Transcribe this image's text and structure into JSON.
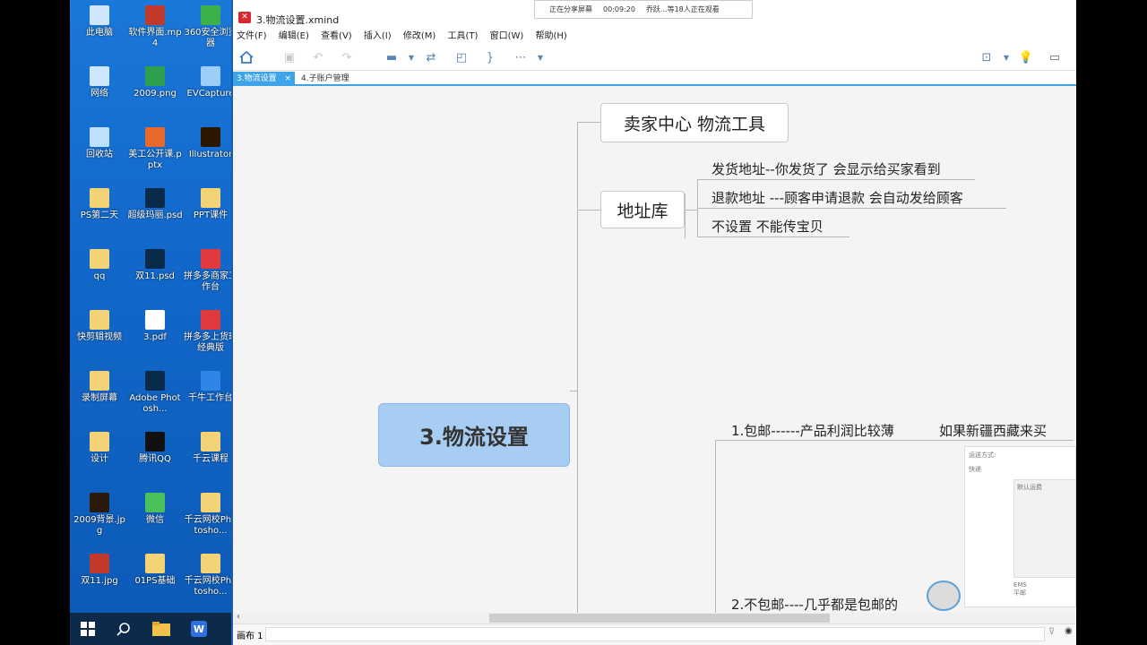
{
  "desktop": {
    "icons": [
      {
        "label": "此电脑",
        "icon": "computer-icon",
        "color": "#cfe6ff"
      },
      {
        "label": "软件界面.mp4",
        "icon": "video-file-icon",
        "color": "#c0392b"
      },
      {
        "label": "360安全浏览器",
        "icon": "browser-360-icon",
        "color": "#3cb04a"
      },
      {
        "label": "网络",
        "icon": "network-icon",
        "color": "#cfe6ff"
      },
      {
        "label": "2009.png",
        "icon": "image-file-icon",
        "color": "#2e9e4f"
      },
      {
        "label": "EVCapture",
        "icon": "evcapture-icon",
        "color": "#9ccef8"
      },
      {
        "label": "回收站",
        "icon": "recycle-bin-icon",
        "color": "#bde0ff"
      },
      {
        "label": "美工公开课.pptx",
        "icon": "pptx-file-icon",
        "color": "#e6682a"
      },
      {
        "label": "Illustrator",
        "icon": "illustrator-icon",
        "color": "#2b1700"
      },
      {
        "label": "PS第二天",
        "icon": "folder-icon",
        "color": "#f3d376"
      },
      {
        "label": "超级玛丽.psd",
        "icon": "psd-file-icon",
        "color": "#0a2a4a"
      },
      {
        "label": "PPT课件",
        "icon": "folder-shortcut-icon",
        "color": "#f3d376"
      },
      {
        "label": "qq",
        "icon": "folder-icon",
        "color": "#f3d376"
      },
      {
        "label": "双11.psd",
        "icon": "psd-file-icon",
        "color": "#0a2a4a"
      },
      {
        "label": "拼多多商家工作台",
        "icon": "pinduoduo-icon",
        "color": "#e0393e"
      },
      {
        "label": "快剪辑视频",
        "icon": "folder-icon",
        "color": "#f3d376"
      },
      {
        "label": "3.pdf",
        "icon": "pdf-file-icon",
        "color": "#ffffff"
      },
      {
        "label": "拼多多上货理经典版",
        "icon": "pinduoduo-icon",
        "color": "#e0393e"
      },
      {
        "label": "录制屏幕",
        "icon": "folder-icon",
        "color": "#f3d376"
      },
      {
        "label": "Adobe Photosh...",
        "icon": "photoshop-icon",
        "color": "#0a2a4a"
      },
      {
        "label": "千牛工作台",
        "icon": "qianniu-icon",
        "color": "#2f86e6"
      },
      {
        "label": "设计",
        "icon": "folder-icon",
        "color": "#f3d376"
      },
      {
        "label": "腾讯QQ",
        "icon": "qq-penguin-icon",
        "color": "#111111"
      },
      {
        "label": "千云课程",
        "icon": "folder-shortcut-icon",
        "color": "#f3d376"
      },
      {
        "label": "2009背景.jpg",
        "icon": "image-file-icon",
        "color": "#2a1a0a"
      },
      {
        "label": "微信",
        "icon": "wechat-icon",
        "color": "#4ac05a"
      },
      {
        "label": "千云网校Photosho...",
        "icon": "folder-shortcut-icon",
        "color": "#f3d376"
      },
      {
        "label": "双11.jpg",
        "icon": "image-file-icon",
        "color": "#c0392b"
      },
      {
        "label": "01PS基础",
        "icon": "folder-shortcut-icon",
        "color": "#f3d376"
      },
      {
        "label": "千云网校Photosho...",
        "icon": "folder-shortcut-icon",
        "color": "#f3d376"
      }
    ]
  },
  "taskbar": {
    "start_icon": "windows-start-icon",
    "search_icon": "search-icon",
    "explorer_icon": "file-explorer-icon",
    "wps_icon": "wps-icon"
  },
  "share_bar": {
    "status": "正在分享屏幕",
    "timer": "00:09:20",
    "viewers": "乔跃...等18人正在观看"
  },
  "app": {
    "title": "3.物流设置.xmind",
    "menu": [
      "文件(F)",
      "编辑(E)",
      "查看(V)",
      "插入(I)",
      "修改(M)",
      "工具(T)",
      "窗口(W)",
      "帮助(H)"
    ],
    "tabs": [
      {
        "label": "3.物流设置",
        "active": true
      },
      {
        "label": "4.子账户管理",
        "active": false
      }
    ],
    "sheet_label": "画布 1",
    "accent": "#3ea4e8"
  },
  "mindmap": {
    "central": "3.物流设置",
    "branch1": "卖家中心 物流工具",
    "branch2": "地址库",
    "branch2_children": [
      "发货地址--你发货了 会显示给买家看到",
      "退款地址 ---顾客申请退款 会自动发给顾客",
      "不设置 不能传宝贝"
    ],
    "bottom1": "1.包邮------产品利润比较薄",
    "bottom1b": "如果新疆西藏来买",
    "bottom2": "2.不包邮----几乎都是包邮的",
    "thumb": {
      "label1": "运送方式:",
      "label2": "快递",
      "label3": "默认运费",
      "label4": "EMS",
      "label5": "平邮"
    }
  }
}
